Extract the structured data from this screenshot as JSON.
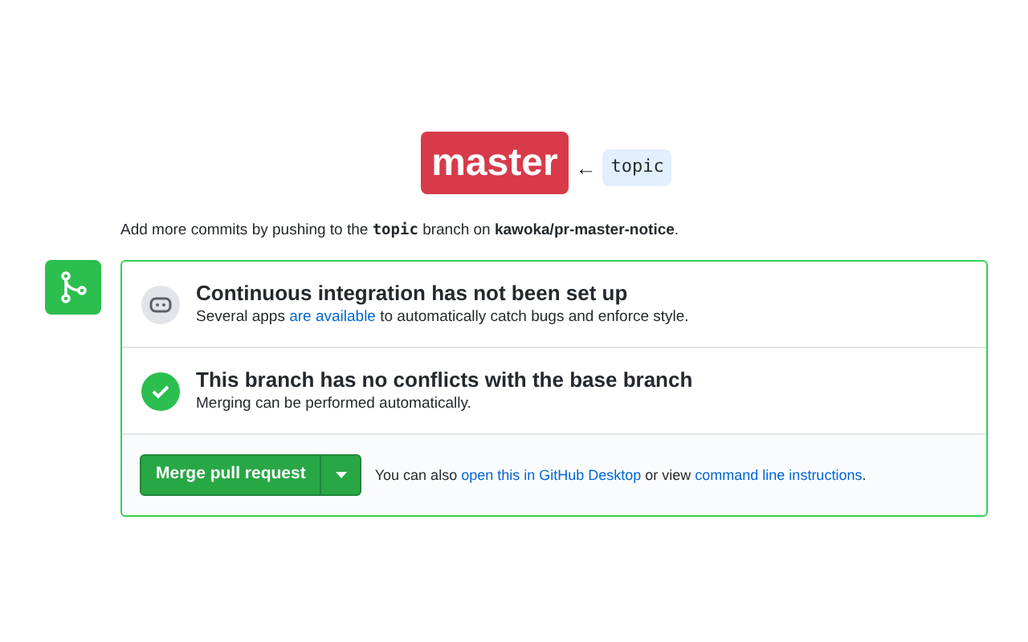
{
  "branch_notice": {
    "base_branch": "master",
    "arrow": "←",
    "head_branch": "topic"
  },
  "instructions": "Add more commits by pushing to the **topic** branch on **kawoka/pr-master-notice**.",
  "checks": [
    {
      "kind": "ci",
      "title": "Continuous integration has not been set up",
      "description": [
        {
          "text": "Several apps ",
          "link": false
        },
        {
          "text": "are available",
          "link": true
        },
        {
          "text": " to automatically catch bugs and enforce style.",
          "link": false
        }
      ]
    },
    {
      "kind": "success",
      "title": "This branch has no conflicts with the base branch",
      "description": [
        {
          "text": "Merging can be performed automatically.",
          "link": false
        }
      ]
    }
  ],
  "merge": {
    "button": "Merge pull request",
    "note": [
      {
        "text": "You can also ",
        "link": false
      },
      {
        "text": "open this in GitHub Desktop",
        "link": true
      },
      {
        "text": " or view ",
        "link": false
      },
      {
        "text": "command line instructions",
        "link": true
      },
      {
        "text": ".",
        "link": false
      }
    ]
  }
}
